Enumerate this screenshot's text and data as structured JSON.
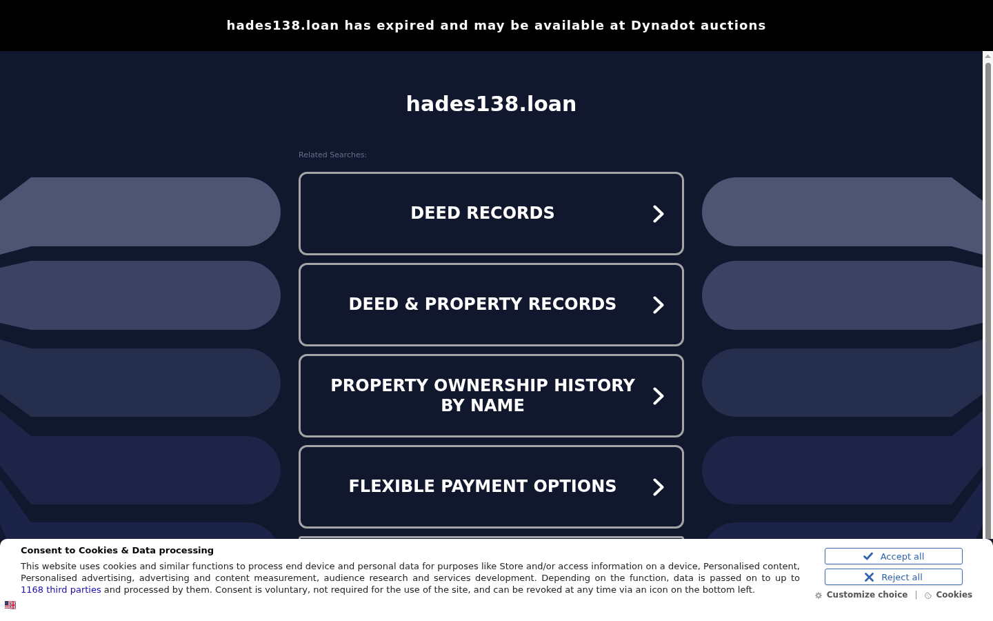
{
  "banner": {
    "text": "hades138.loan has expired and may be available at Dynadot auctions"
  },
  "domain_title": "hades138.loan",
  "related_searches": {
    "label": "Related Searches:",
    "links": [
      "DEED RECORDS",
      "DEED & PROPERTY RECORDS",
      "PROPERTY OWNERSHIP HISTORY BY NAME",
      "FLEXIBLE PAYMENT OPTIONS"
    ]
  },
  "consent": {
    "title": "Consent to Cookies & Data processing",
    "text_before": "This website uses cookies and similar functions to process end device and personal data for purposes like Store and/or access information on a device, Personalised content, Personalised advertising, advertising and content measurement, audience research and services development. Depending on the function, data is passed on to up to",
    "link": "1168 third parties",
    "text_after": "and processed by them. Consent is voluntary, not required for the use of the site, and can be revoked at any time via an icon on the bottom left.",
    "buttons": [
      {
        "kind": "accept",
        "label": "Accept all"
      },
      {
        "kind": "reject",
        "label": "Reject all"
      }
    ],
    "footer_links": [
      {
        "kind": "customize",
        "label": "Customize choice"
      },
      {
        "kind": "cookies",
        "label": "Cookies"
      }
    ],
    "separator": "|"
  }
}
